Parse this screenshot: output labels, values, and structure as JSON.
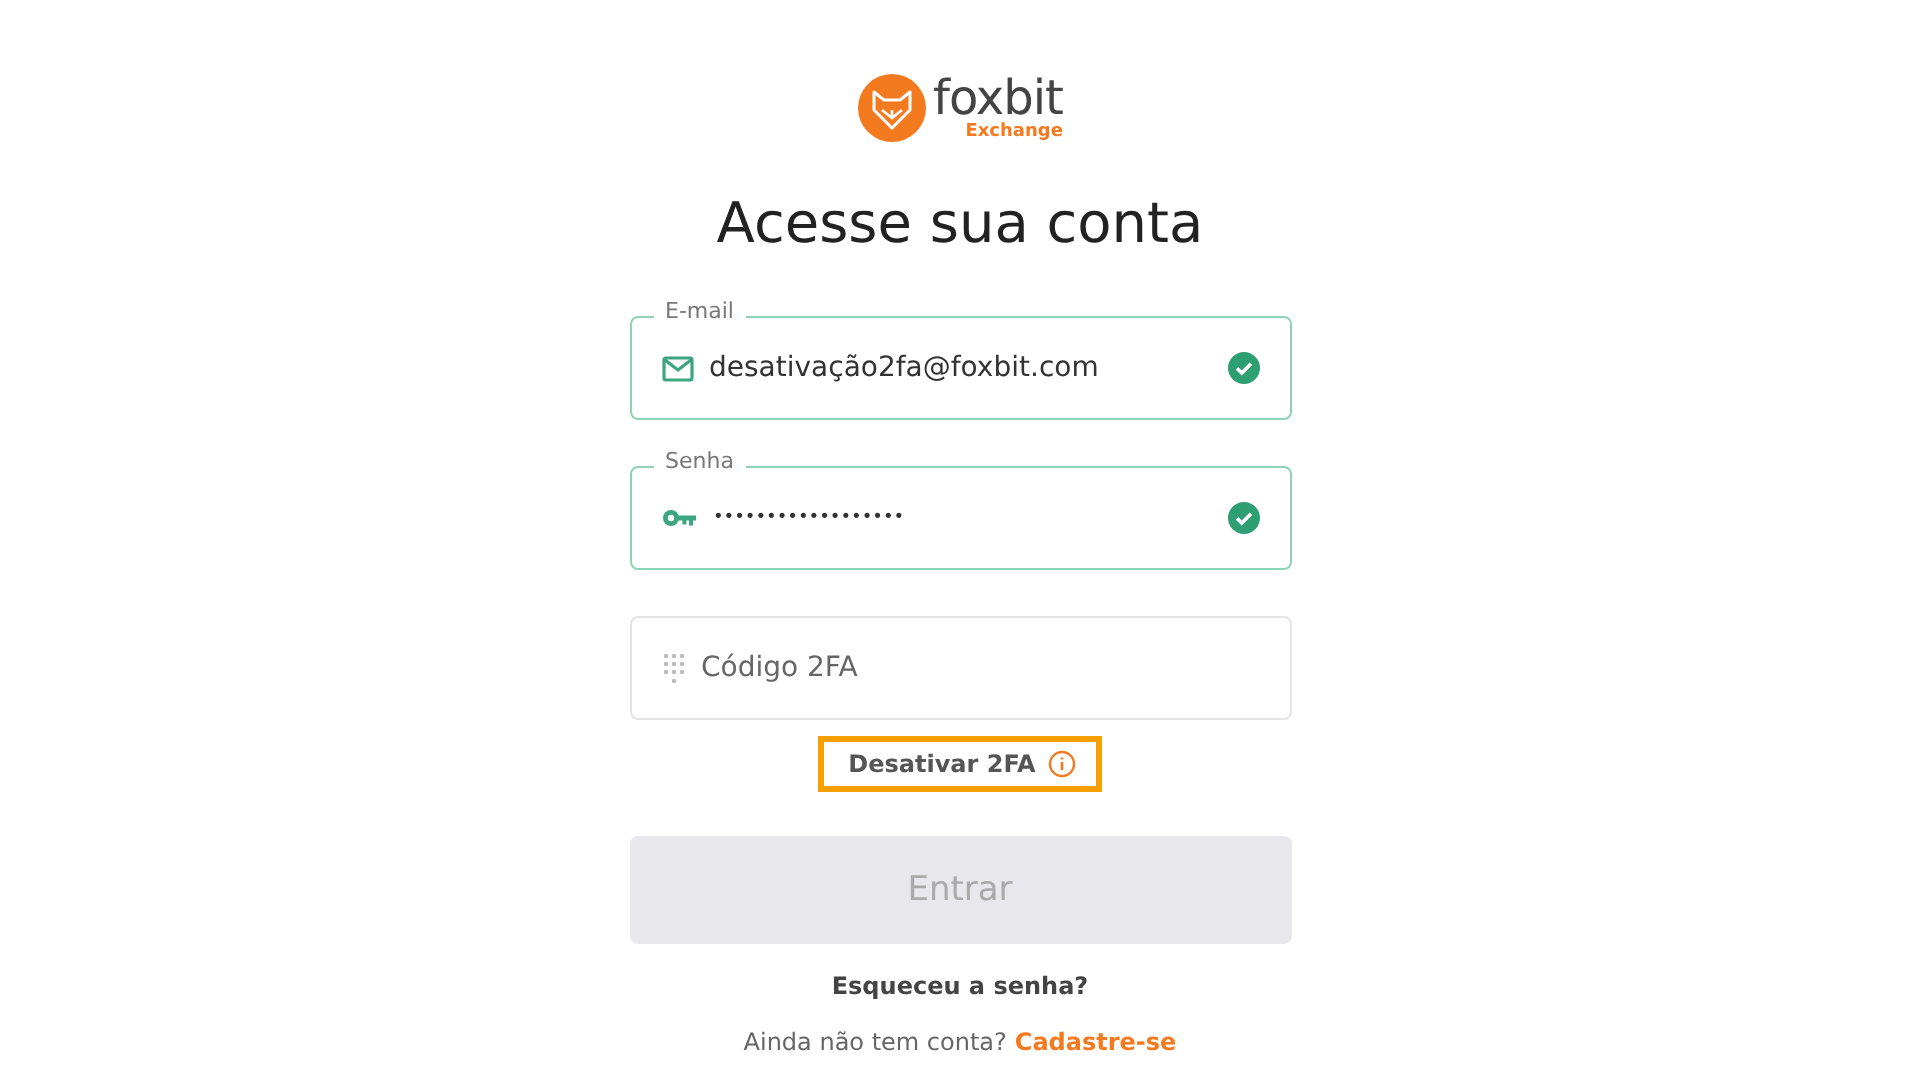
{
  "logo": {
    "name": "foxbit",
    "subtitle": "Exchange"
  },
  "title": "Acesse sua conta",
  "fields": [
    {
      "kind": "email",
      "label": "E-mail",
      "value": "desativação2fa@foxbit.com",
      "valid": true
    },
    {
      "kind": "password",
      "label": "Senha",
      "value": "••••••••••••••••••",
      "valid": true
    },
    {
      "kind": "code",
      "placeholder": "Código 2FA",
      "valid": false
    }
  ],
  "disable_2fa_link": {
    "label": "Desativar 2FA",
    "highlighted": true
  },
  "submit_button": {
    "label": "Entrar",
    "disabled": true
  },
  "forgot_link": "Esqueceu a senha?",
  "signup": {
    "text": "Ainda não tem conta?",
    "link": "Cadastre-se"
  }
}
